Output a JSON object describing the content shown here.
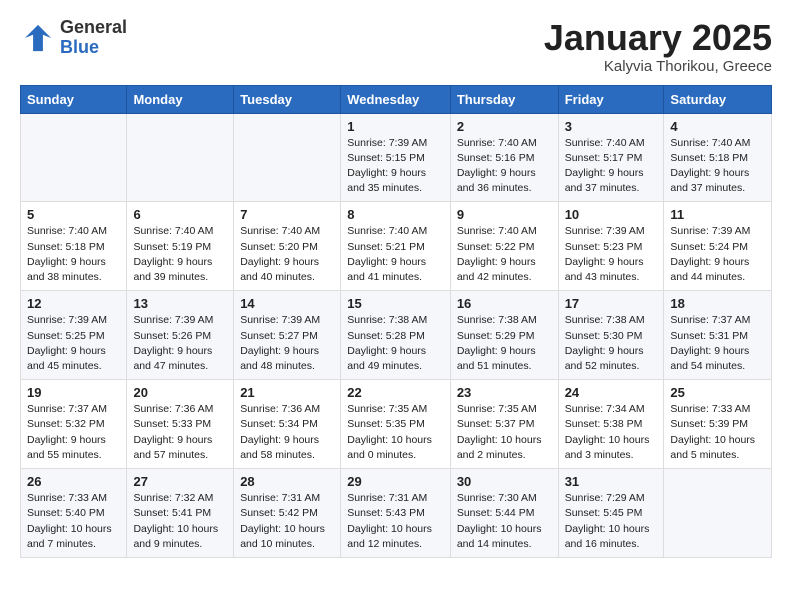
{
  "header": {
    "logo_general": "General",
    "logo_blue": "Blue",
    "month_title": "January 2025",
    "location": "Kalyvia Thorikou, Greece"
  },
  "weekdays": [
    "Sunday",
    "Monday",
    "Tuesday",
    "Wednesday",
    "Thursday",
    "Friday",
    "Saturday"
  ],
  "weeks": [
    [
      {
        "day": "",
        "info": ""
      },
      {
        "day": "",
        "info": ""
      },
      {
        "day": "",
        "info": ""
      },
      {
        "day": "1",
        "info": "Sunrise: 7:39 AM\nSunset: 5:15 PM\nDaylight: 9 hours and 35 minutes."
      },
      {
        "day": "2",
        "info": "Sunrise: 7:40 AM\nSunset: 5:16 PM\nDaylight: 9 hours and 36 minutes."
      },
      {
        "day": "3",
        "info": "Sunrise: 7:40 AM\nSunset: 5:17 PM\nDaylight: 9 hours and 37 minutes."
      },
      {
        "day": "4",
        "info": "Sunrise: 7:40 AM\nSunset: 5:18 PM\nDaylight: 9 hours and 37 minutes."
      }
    ],
    [
      {
        "day": "5",
        "info": "Sunrise: 7:40 AM\nSunset: 5:18 PM\nDaylight: 9 hours and 38 minutes."
      },
      {
        "day": "6",
        "info": "Sunrise: 7:40 AM\nSunset: 5:19 PM\nDaylight: 9 hours and 39 minutes."
      },
      {
        "day": "7",
        "info": "Sunrise: 7:40 AM\nSunset: 5:20 PM\nDaylight: 9 hours and 40 minutes."
      },
      {
        "day": "8",
        "info": "Sunrise: 7:40 AM\nSunset: 5:21 PM\nDaylight: 9 hours and 41 minutes."
      },
      {
        "day": "9",
        "info": "Sunrise: 7:40 AM\nSunset: 5:22 PM\nDaylight: 9 hours and 42 minutes."
      },
      {
        "day": "10",
        "info": "Sunrise: 7:39 AM\nSunset: 5:23 PM\nDaylight: 9 hours and 43 minutes."
      },
      {
        "day": "11",
        "info": "Sunrise: 7:39 AM\nSunset: 5:24 PM\nDaylight: 9 hours and 44 minutes."
      }
    ],
    [
      {
        "day": "12",
        "info": "Sunrise: 7:39 AM\nSunset: 5:25 PM\nDaylight: 9 hours and 45 minutes."
      },
      {
        "day": "13",
        "info": "Sunrise: 7:39 AM\nSunset: 5:26 PM\nDaylight: 9 hours and 47 minutes."
      },
      {
        "day": "14",
        "info": "Sunrise: 7:39 AM\nSunset: 5:27 PM\nDaylight: 9 hours and 48 minutes."
      },
      {
        "day": "15",
        "info": "Sunrise: 7:38 AM\nSunset: 5:28 PM\nDaylight: 9 hours and 49 minutes."
      },
      {
        "day": "16",
        "info": "Sunrise: 7:38 AM\nSunset: 5:29 PM\nDaylight: 9 hours and 51 minutes."
      },
      {
        "day": "17",
        "info": "Sunrise: 7:38 AM\nSunset: 5:30 PM\nDaylight: 9 hours and 52 minutes."
      },
      {
        "day": "18",
        "info": "Sunrise: 7:37 AM\nSunset: 5:31 PM\nDaylight: 9 hours and 54 minutes."
      }
    ],
    [
      {
        "day": "19",
        "info": "Sunrise: 7:37 AM\nSunset: 5:32 PM\nDaylight: 9 hours and 55 minutes."
      },
      {
        "day": "20",
        "info": "Sunrise: 7:36 AM\nSunset: 5:33 PM\nDaylight: 9 hours and 57 minutes."
      },
      {
        "day": "21",
        "info": "Sunrise: 7:36 AM\nSunset: 5:34 PM\nDaylight: 9 hours and 58 minutes."
      },
      {
        "day": "22",
        "info": "Sunrise: 7:35 AM\nSunset: 5:35 PM\nDaylight: 10 hours and 0 minutes."
      },
      {
        "day": "23",
        "info": "Sunrise: 7:35 AM\nSunset: 5:37 PM\nDaylight: 10 hours and 2 minutes."
      },
      {
        "day": "24",
        "info": "Sunrise: 7:34 AM\nSunset: 5:38 PM\nDaylight: 10 hours and 3 minutes."
      },
      {
        "day": "25",
        "info": "Sunrise: 7:33 AM\nSunset: 5:39 PM\nDaylight: 10 hours and 5 minutes."
      }
    ],
    [
      {
        "day": "26",
        "info": "Sunrise: 7:33 AM\nSunset: 5:40 PM\nDaylight: 10 hours and 7 minutes."
      },
      {
        "day": "27",
        "info": "Sunrise: 7:32 AM\nSunset: 5:41 PM\nDaylight: 10 hours and 9 minutes."
      },
      {
        "day": "28",
        "info": "Sunrise: 7:31 AM\nSunset: 5:42 PM\nDaylight: 10 hours and 10 minutes."
      },
      {
        "day": "29",
        "info": "Sunrise: 7:31 AM\nSunset: 5:43 PM\nDaylight: 10 hours and 12 minutes."
      },
      {
        "day": "30",
        "info": "Sunrise: 7:30 AM\nSunset: 5:44 PM\nDaylight: 10 hours and 14 minutes."
      },
      {
        "day": "31",
        "info": "Sunrise: 7:29 AM\nSunset: 5:45 PM\nDaylight: 10 hours and 16 minutes."
      },
      {
        "day": "",
        "info": ""
      }
    ]
  ]
}
